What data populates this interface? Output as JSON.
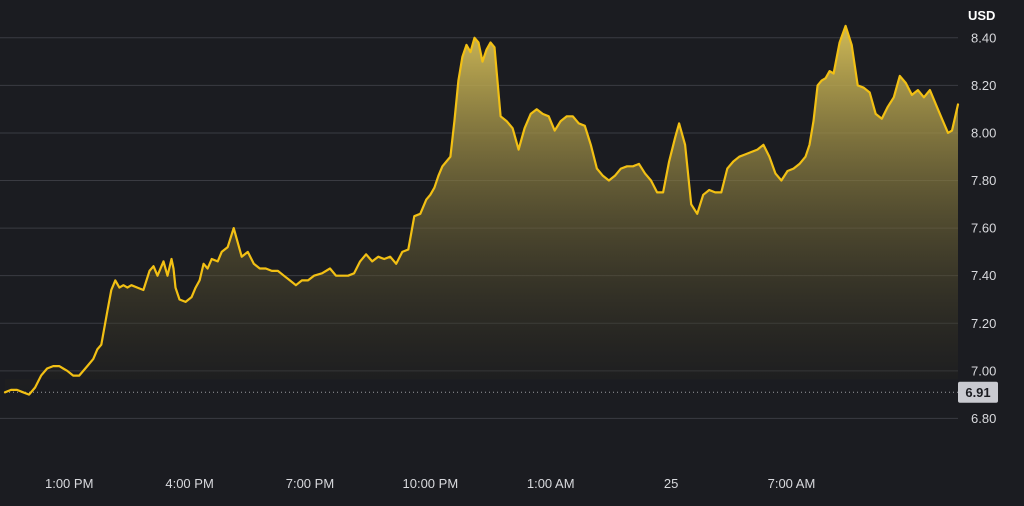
{
  "colors": {
    "background": "#1b1c21",
    "grid": "#3a3b42",
    "line": "#f2c014",
    "fill_top": "#d9c25a",
    "fill_bottom": "#1f1f1c",
    "baseline": "#9b9ca1",
    "last_price_bg": "#c9cad0",
    "last_price_text": "#1b1c21",
    "axis_text": "#d8d9dd"
  },
  "chart_data": {
    "type": "area",
    "ylabel": "USD",
    "ylim": [
      6.6,
      8.5
    ],
    "y_ticks": [
      "8.40",
      "8.20",
      "8.00",
      "7.80",
      "7.60",
      "7.40",
      "7.20",
      "7.00",
      "6.80"
    ],
    "x_ticks": [
      "1:00 PM",
      "4:00 PM",
      "7:00 PM",
      "10:00 PM",
      "1:00 AM",
      "25",
      "7:00 AM"
    ],
    "x_tick_hours": [
      1,
      4,
      7,
      10,
      13,
      16,
      19
    ],
    "xlim_hours": [
      -0.6,
      23.15
    ],
    "grid": true,
    "baseline_value": 6.91,
    "last_price_label": "6.91",
    "series": [
      {
        "x_hours": [
          -0.6,
          -0.45,
          -0.3,
          -0.15,
          0.0,
          0.15,
          0.3,
          0.45,
          0.6,
          0.75,
          0.85,
          0.95,
          1.1,
          1.25,
          1.45,
          1.6,
          1.7,
          1.8,
          1.95,
          2.05,
          2.15,
          2.25,
          2.35,
          2.45,
          2.55,
          2.7,
          2.85,
          3.0,
          3.1,
          3.2,
          3.35,
          3.45,
          3.55,
          3.6,
          3.65,
          3.75,
          3.9,
          4.05,
          4.15,
          4.25,
          4.35,
          4.45,
          4.55,
          4.7,
          4.8,
          4.95,
          5.1,
          5.3,
          5.45,
          5.6,
          5.75,
          5.9,
          6.05,
          6.2,
          6.35,
          6.5,
          6.65,
          6.8,
          6.95,
          7.1,
          7.3,
          7.5,
          7.65,
          7.8,
          7.95,
          8.1,
          8.25,
          8.4,
          8.55,
          8.7,
          8.85,
          9.0,
          9.15,
          9.3,
          9.45,
          9.6,
          9.75,
          9.9,
          10.0,
          10.1,
          10.2,
          10.3,
          10.4,
          10.5,
          10.6,
          10.7,
          10.8,
          10.9,
          11.0,
          11.1,
          11.2,
          11.3,
          11.4,
          11.5,
          11.6,
          11.75,
          11.9,
          12.05,
          12.2,
          12.35,
          12.5,
          12.65,
          12.8,
          12.95,
          13.1,
          13.25,
          13.4,
          13.55,
          13.7,
          13.85,
          14.0,
          14.15,
          14.3,
          14.45,
          14.6,
          14.75,
          14.9,
          15.05,
          15.2,
          15.35,
          15.5,
          15.65,
          15.8,
          15.95,
          16.1,
          16.2,
          16.35,
          16.5,
          16.65,
          16.8,
          16.95,
          17.1,
          17.25,
          17.4,
          17.55,
          17.7,
          17.85,
          18.0,
          18.15,
          18.3,
          18.45,
          18.6,
          18.75,
          18.9,
          19.05,
          19.2,
          19.35,
          19.45,
          19.55,
          19.65,
          19.75,
          19.85,
          19.95,
          20.05,
          20.2,
          20.35,
          20.5,
          20.65,
          20.8,
          20.95,
          21.1,
          21.25,
          21.4,
          21.55,
          21.7,
          21.85,
          22.0,
          22.15,
          22.3,
          22.45,
          22.6,
          22.75,
          22.9,
          23.0,
          23.15
        ],
        "values": [
          6.91,
          6.92,
          6.92,
          6.91,
          6.9,
          6.93,
          6.98,
          7.01,
          7.02,
          7.02,
          7.01,
          7.0,
          6.98,
          6.98,
          7.02,
          7.05,
          7.09,
          7.11,
          7.25,
          7.34,
          7.38,
          7.35,
          7.36,
          7.35,
          7.36,
          7.35,
          7.34,
          7.42,
          7.44,
          7.4,
          7.46,
          7.4,
          7.47,
          7.43,
          7.35,
          7.3,
          7.29,
          7.31,
          7.35,
          7.38,
          7.45,
          7.43,
          7.47,
          7.46,
          7.5,
          7.52,
          7.6,
          7.48,
          7.5,
          7.45,
          7.43,
          7.43,
          7.42,
          7.42,
          7.4,
          7.38,
          7.36,
          7.38,
          7.38,
          7.4,
          7.41,
          7.43,
          7.4,
          7.4,
          7.4,
          7.41,
          7.46,
          7.49,
          7.46,
          7.48,
          7.47,
          7.48,
          7.45,
          7.5,
          7.51,
          7.65,
          7.66,
          7.72,
          7.74,
          7.77,
          7.82,
          7.86,
          7.88,
          7.9,
          8.05,
          8.22,
          8.32,
          8.37,
          8.34,
          8.4,
          8.38,
          8.3,
          8.35,
          8.38,
          8.36,
          8.07,
          8.05,
          8.02,
          7.93,
          8.02,
          8.08,
          8.1,
          8.08,
          8.07,
          8.01,
          8.05,
          8.07,
          8.07,
          8.04,
          8.03,
          7.95,
          7.85,
          7.82,
          7.8,
          7.82,
          7.85,
          7.86,
          7.86,
          7.87,
          7.83,
          7.8,
          7.75,
          7.75,
          7.88,
          7.98,
          8.04,
          7.95,
          7.7,
          7.66,
          7.74,
          7.76,
          7.75,
          7.75,
          7.85,
          7.88,
          7.9,
          7.91,
          7.92,
          7.93,
          7.95,
          7.9,
          7.83,
          7.8,
          7.84,
          7.85,
          7.87,
          7.9,
          7.95,
          8.05,
          8.2,
          8.22,
          8.23,
          8.26,
          8.25,
          8.38,
          8.45,
          8.37,
          8.2,
          8.19,
          8.17,
          8.08,
          8.06,
          8.11,
          8.15,
          8.24,
          8.21,
          8.16,
          8.18,
          8.15,
          8.18,
          8.12,
          8.06,
          8.0,
          8.01,
          8.12,
          8.02
        ]
      }
    ]
  }
}
